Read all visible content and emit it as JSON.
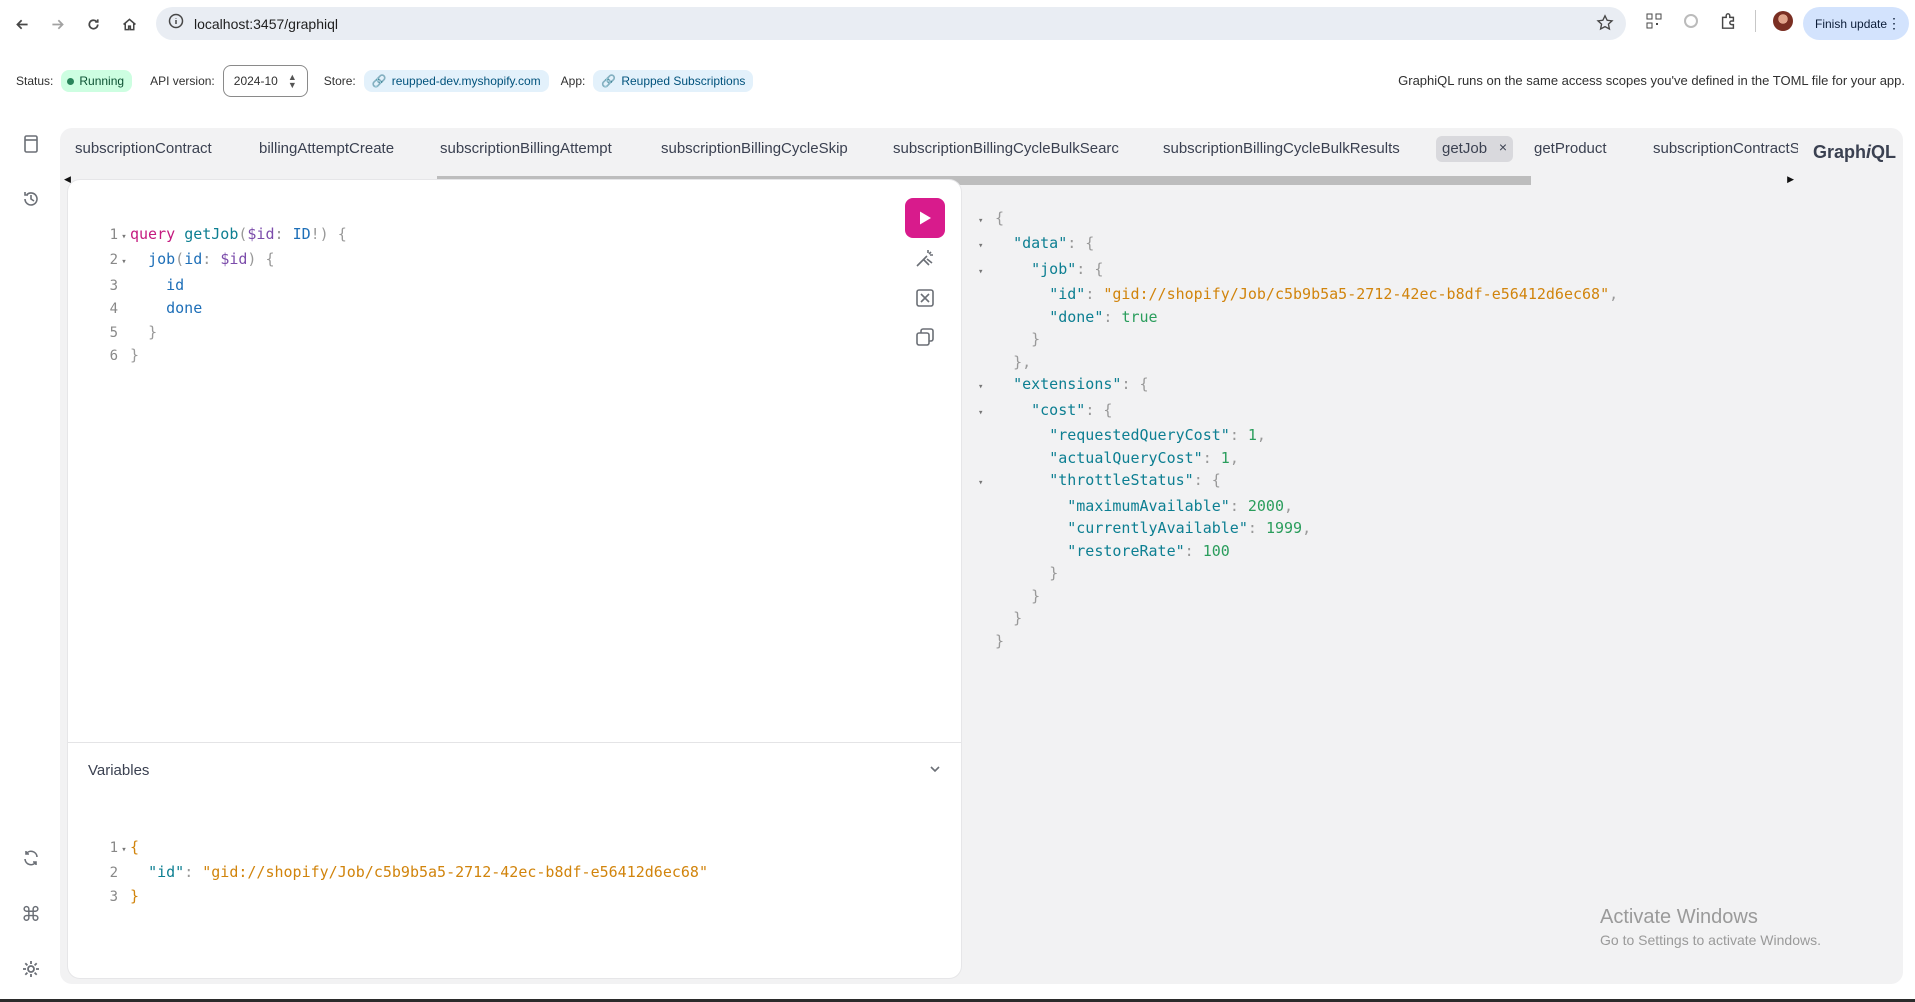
{
  "browser": {
    "url": "localhost:3457/graphiql",
    "finish_update_label": "Finish update"
  },
  "status_bar": {
    "status_label": "Status:",
    "status_value": "Running",
    "api_version_label": "API version:",
    "api_version_value": "2024-10",
    "store_label": "Store:",
    "store_value": "reupped-dev.myshopify.com",
    "app_label": "App:",
    "app_value": "Reupped Subscriptions",
    "scopes_note": "GraphiQL runs on the same access scopes you've defined in the TOML file for your app."
  },
  "tabs": [
    {
      "label": "subscriptionContract"
    },
    {
      "label": "billingAttemptCreate"
    },
    {
      "label": "subscriptionBillingAttempt"
    },
    {
      "label": "subscriptionBillingCycleSkip"
    },
    {
      "label": "subscriptionBillingCycleBulkSearc"
    },
    {
      "label": "subscriptionBillingCycleBulkResults"
    },
    {
      "label": "getJob",
      "active": true
    },
    {
      "label": "getProduct"
    },
    {
      "label": "subscriptionContractS"
    }
  ],
  "graphiql_title": {
    "prefix": "Graph",
    "italic": "i",
    "suffix": "QL"
  },
  "query": {
    "keyword": "query",
    "operation_name": "getJob",
    "variable": "$id",
    "variable_type": "ID",
    "field": "job",
    "arg_name": "id",
    "arg_value": "$id",
    "subfield_1": "id",
    "subfield_2": "done"
  },
  "variables": {
    "title": "Variables",
    "key": "\"id\"",
    "value": "\"gid://shopify/Job/c5b9b5a5-2712-42ec-b8df-e56412d6ec68\""
  },
  "result": {
    "data_key": "\"data\"",
    "job_key": "\"job\"",
    "id_key": "\"id\"",
    "id_value": "\"gid://shopify/Job/c5b9b5a5-2712-42ec-b8df-e56412d6ec68\"",
    "done_key": "\"done\"",
    "done_value": "true",
    "extensions_key": "\"extensions\"",
    "cost_key": "\"cost\"",
    "requested_key": "\"requestedQueryCost\"",
    "requested_value": "1",
    "actual_key": "\"actualQueryCost\"",
    "actual_value": "1",
    "throttle_key": "\"throttleStatus\"",
    "max_key": "\"maximumAvailable\"",
    "max_value": "2000",
    "current_key": "\"currentlyAvailable\"",
    "current_value": "1999",
    "restore_key": "\"restoreRate\"",
    "restore_value": "100"
  },
  "watermark": {
    "line1": "Activate Windows",
    "line2": "Go to Settings to activate Windows."
  },
  "colors": {
    "run_button": "#d81b8c",
    "running_badge": "#cdfee1",
    "link_pill": "#e3f1fb"
  }
}
